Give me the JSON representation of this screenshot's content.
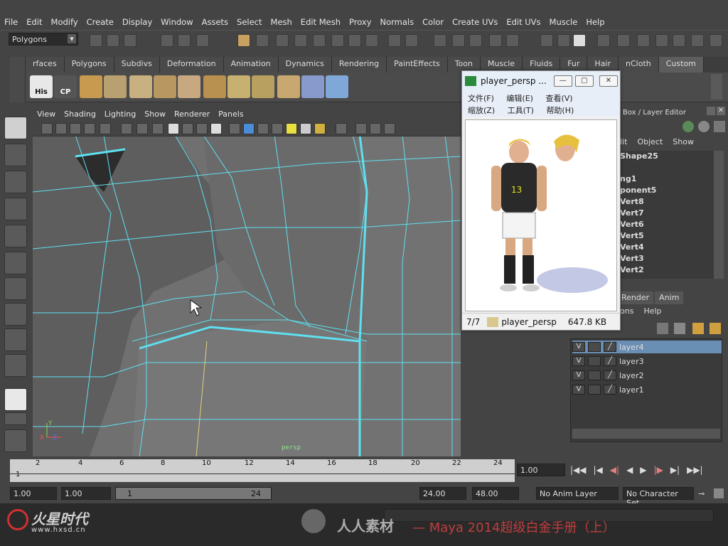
{
  "menubar": [
    "File",
    "Edit",
    "Modify",
    "Create",
    "Display",
    "Window",
    "Assets",
    "Select",
    "Mesh",
    "Edit Mesh",
    "Proxy",
    "Normals",
    "Color",
    "Create UVs",
    "Edit UVs",
    "Muscle",
    "Help"
  ],
  "status_line": {
    "mode": "Polygons"
  },
  "shelf": {
    "tabs": [
      "rfaces",
      "Polygons",
      "Subdivs",
      "Deformation",
      "Animation",
      "Dynamics",
      "Rendering",
      "PaintEffects",
      "Toon",
      "Muscle",
      "Fluids",
      "Fur",
      "Hair",
      "nCloth",
      "Custom"
    ],
    "active_tab": "Custom",
    "icons": [
      "His",
      "CP"
    ]
  },
  "viewport": {
    "menus": [
      "View",
      "Shading",
      "Lighting",
      "Show",
      "Renderer",
      "Panels"
    ],
    "camera_label": "persp",
    "wire_color": "#5fe0f0",
    "mesh_color": "#7a7a7a"
  },
  "right_panel": {
    "header": "Box / Layer Editor",
    "menus": [
      "lit",
      "Object",
      "Show"
    ],
    "outliner_items": [
      "Shape25",
      "ng1",
      "ponent5",
      "Vert8",
      "Vert7",
      "Vert6",
      "Vert5",
      "Vert4",
      "Vert3",
      "Vert2"
    ],
    "layer_tabs": [
      "Render",
      "Anim"
    ],
    "layer_menus": [
      "ons",
      "Help"
    ],
    "layers": [
      {
        "vis": "V",
        "name": "layer4",
        "selected": true
      },
      {
        "vis": "V",
        "name": "layer3",
        "selected": false
      },
      {
        "vis": "V",
        "name": "layer2",
        "selected": false
      },
      {
        "vis": "V",
        "name": "layer1",
        "selected": false
      }
    ]
  },
  "image_viewer": {
    "title": "player_persp ...",
    "menu_row1": [
      "文件(F)",
      "编辑(E)",
      "查看(V)"
    ],
    "menu_row2": [
      "缩放(Z)",
      "工具(T)",
      "帮助(H)"
    ],
    "status_index": "7/7",
    "status_filename": "player_persp",
    "status_size": "647.8 KB",
    "jersey_number": "13"
  },
  "timeline": {
    "ticks": [
      "1",
      "2",
      "4",
      "6",
      "8",
      "10",
      "12",
      "14",
      "16",
      "18",
      "20",
      "22",
      "24"
    ],
    "current_frame": "1.00"
  },
  "range_slider": {
    "start": "1.00",
    "start2": "1.00",
    "inner_start": "1",
    "inner_end": "24",
    "end": "24.00",
    "end2": "48.00",
    "anim_layer": "No Anim Layer",
    "char_set": "No Character Set"
  },
  "watermark": {
    "logo": "火星时代",
    "url": "www.hxsd.cn",
    "center": "人人素材",
    "title": "— Maya 2014超级白金手册（上）"
  }
}
